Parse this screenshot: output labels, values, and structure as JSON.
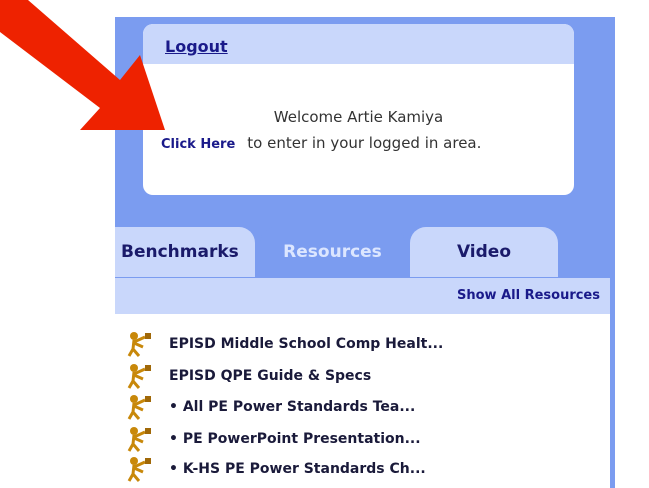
{
  "login": {
    "logout_label": "Logout",
    "welcome_text": "Welcome Artie Kamiya",
    "click_here_label": "Click Here",
    "enter_text": "to enter in your logged in area."
  },
  "tabs": [
    {
      "label": "Benchmarks",
      "active": false
    },
    {
      "label": "Resources",
      "active": true
    },
    {
      "label": "Video",
      "active": false
    }
  ],
  "resources": {
    "show_all_label": "Show All Resources",
    "items": [
      {
        "label": "EPISD Middle School Comp Healt...",
        "icon": "pe-figure-icon"
      },
      {
        "label": "EPISD QPE Guide & Specs",
        "icon": "pe-figure-icon"
      },
      {
        "label": "• All PE Power Standards Tea...",
        "icon": "pe-figure-icon"
      },
      {
        "label": "• PE PowerPoint Presentation...",
        "icon": "pe-figure-icon"
      },
      {
        "label": "• K-HS PE Power Standards Ch...",
        "icon": "pe-figure-icon"
      }
    ]
  },
  "colors": {
    "panel": "#7b9cf0",
    "light_tab": "#c9d7fb",
    "link": "#1a1a8a",
    "arrow": "#ee2200"
  }
}
